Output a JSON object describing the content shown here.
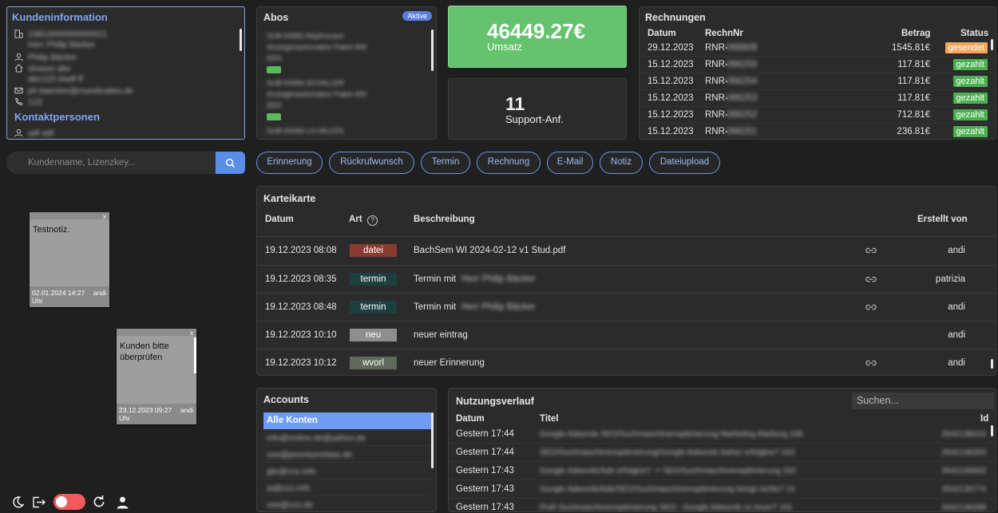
{
  "kunde": {
    "title": "Kundeninformation",
    "fields": [
      "23813000000000021",
      "Herr Philip Bäcker",
      "Philip Bäcker",
      "strasse abc",
      "abc123 stadt ff",
      "ph.baecker@roundcubes.de",
      "123"
    ],
    "kontakt_title": "Kontaktpersonen",
    "kontakt": [
      "adf adf"
    ]
  },
  "search": {
    "placeholder": "Kundenname, Lizenzkey..."
  },
  "notes": [
    {
      "text": "Testnotiz.",
      "date": "02.01.2024 14:27 Uhr",
      "author": "andi",
      "close": "x"
    },
    {
      "text": "Kunden bitte überprüfen",
      "date": "23.12.2023 09:27 Uhr",
      "author": "andi",
      "close": "x"
    }
  ],
  "abos": {
    "title": "Abos",
    "badge": "Aktive",
    "items": [
      {
        "id": "SUB-04581-Nephrocare",
        "desc": "Anzeigenautomation Paket 400",
        "plan": "DDX",
        "tag": "aktiv"
      },
      {
        "id": "SUB-04584-SCHALLER",
        "desc": "Anzeigenautomation Paket 400",
        "plan": "DDX",
        "tag": "aktiv"
      },
      {
        "id": "SUB-04265-LS-HELIOS",
        "desc": "",
        "plan": "",
        "tag": ""
      }
    ]
  },
  "umsatz": {
    "value": "46449.27€",
    "label": "Umsatz"
  },
  "support": {
    "value": "11",
    "label": "Support-Anf."
  },
  "rechnungen": {
    "title": "Rechnungen",
    "headers": {
      "datum": "Datum",
      "nr": "RechnNr",
      "betrag": "Betrag",
      "status": "Status"
    },
    "rows": [
      {
        "datum": "29.12.2023",
        "nr_prefix": "RNR-",
        "nr": "066808",
        "betrag": "1545.81€",
        "status": "gesendet"
      },
      {
        "datum": "15.12.2023",
        "nr_prefix": "RNR-",
        "nr": "066255",
        "betrag": "117.81€",
        "status": "gezahlt"
      },
      {
        "datum": "15.12.2023",
        "nr_prefix": "RNR-",
        "nr": "066254",
        "betrag": "117.81€",
        "status": "gezahlt"
      },
      {
        "datum": "15.12.2023",
        "nr_prefix": "RNR-",
        "nr": "066253",
        "betrag": "117.81€",
        "status": "gezahlt"
      },
      {
        "datum": "15.12.2023",
        "nr_prefix": "RNR-",
        "nr": "066252",
        "betrag": "712.81€",
        "status": "gezahlt"
      },
      {
        "datum": "15.12.2023",
        "nr_prefix": "RNR-",
        "nr": "066251",
        "betrag": "236.81€",
        "status": "gezahlt"
      }
    ]
  },
  "actions": [
    "Erinnerung",
    "Rückrufwunsch",
    "Termin",
    "Rechnung",
    "E-Mail",
    "Notiz",
    "Dateiupload"
  ],
  "kartei": {
    "title": "Karteikarte",
    "headers": {
      "datum": "Datum",
      "art": "Art",
      "beschreibung": "Beschreibung",
      "erstellt": "Erstellt von"
    },
    "rows": [
      {
        "datum": "19.12.2023 08:08",
        "art": "datei",
        "color": "#8b3a30",
        "desc": "BachSem WI 2024-02-12 v1 Stud.pdf",
        "blur": "",
        "link": true,
        "by": "andi"
      },
      {
        "datum": "19.12.2023 08:35",
        "art": "termin",
        "color": "#1d3f40",
        "desc": "Termin mit",
        "blur": "Herr Philip Bäcker",
        "link": true,
        "by": "patrizia"
      },
      {
        "datum": "19.12.2023 08:48",
        "art": "termin",
        "color": "#1d3f40",
        "desc": "Termin mit",
        "blur": "Herr Philip Bäcker",
        "link": true,
        "by": "andi"
      },
      {
        "datum": "19.12.2023 10:10",
        "art": "neu",
        "color": "#8e8e8e",
        "desc": "neuer eintrag",
        "blur": "",
        "link": false,
        "by": "andi"
      },
      {
        "datum": "19.12.2023 10:12",
        "art": "wvorl",
        "color": "#5f6a5a",
        "desc": "neuer Erinnerung",
        "blur": "",
        "link": true,
        "by": "andi"
      }
    ]
  },
  "accounts": {
    "title": "Accounts",
    "items": [
      "Alle Konten",
      "info@online.de@yahoo.de",
      "cee@premiumclass.de",
      "gbr@ccs.info",
      "ai@ccs.info",
      "cee@ccs.de"
    ]
  },
  "nutzung": {
    "title": "Nutzungsverlauf",
    "search_placeholder": "Suchen...",
    "headers": {
      "datum": "Datum",
      "titel": "Titel",
      "id": "Id"
    },
    "rows": [
      {
        "datum": "Gestern 17:44",
        "titel": "Google Adwords SEO/Suchmaschinenoptimierung Marketing Marburg 168",
        "id": "2642138410"
      },
      {
        "datum": "Gestern 17:44",
        "titel": "SEO/Suchmaschinenoptimierung/Google Adwords bisher erfolglos? 163",
        "id": "2642136263"
      },
      {
        "datum": "Gestern 17:43",
        "titel": "Google Adwords/Ads erfolglos? -> SEO/Suchmaschinenoptimierung 152",
        "id": "2642135663"
      },
      {
        "datum": "Gestern 17:43",
        "titel": "Google Adwords/Ads/SEO/Suchmaschinenoptimierung bringt nichts? 14",
        "id": "2642136774"
      },
      {
        "datum": "Gestern 17:43",
        "titel": "Profi Suchmaschinenoptimierung SEO - Google Adwords zu teuer? 101",
        "id": "2642136288"
      }
    ]
  }
}
